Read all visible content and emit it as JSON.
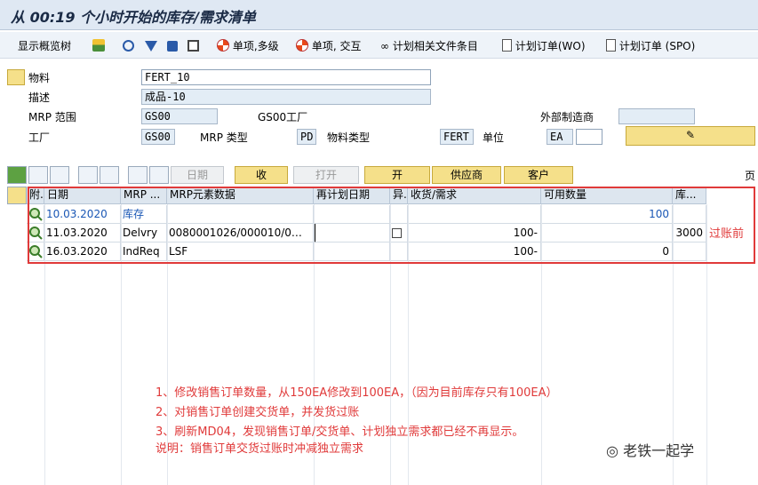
{
  "title": "从 00:19 个小时开始的库存/需求清单",
  "toolbar": {
    "overview": "显示概览树",
    "single_multi": "单项,多级",
    "single_interactive": "单项, 交互",
    "plan_docs": "计划相关文件条目",
    "plan_order_wo": "计划订单(WO)",
    "plan_order_spo": "计划订单 (SPO)"
  },
  "header": {
    "material_label": "物料",
    "material_value": "FERT_10",
    "desc_label": "描述",
    "desc_value": "成品-10",
    "mrp_area_label": "MRP 范围",
    "mrp_area_value": "GS00",
    "mrp_area_text": "GS00工厂",
    "ext_proc_label": "外部制造商",
    "plant_label": "工厂",
    "plant_value": "GS00",
    "mrp_type_label": "MRP 类型",
    "mrp_type_value": "PD",
    "mat_type_label": "物料类型",
    "mat_type_value": "FERT",
    "unit_label": "单位",
    "unit_value": "EA"
  },
  "action_buttons": {
    "date": "日期",
    "receive": "收",
    "open": "打开",
    "open2": "开",
    "vendor": "供应商",
    "customer": "客户",
    "page": "页"
  },
  "grid": {
    "columns": [
      "附.",
      "日期",
      "MRP ...",
      "MRP元素数据",
      "再计划日期",
      "异.",
      "收货/需求",
      "可用数量",
      "库..."
    ],
    "rows": [
      {
        "date": "10.03.2020",
        "mrp": "库存",
        "elem": "",
        "resched": "",
        "exc": "",
        "recv": "",
        "avail": "100",
        "stor": "",
        "blue": true
      },
      {
        "date": "11.03.2020",
        "mrp": "Delvry",
        "elem": "0080001026/000010/0…",
        "resched": "",
        "exc": "",
        "recv": "100-",
        "avail": "",
        "stor": "3000",
        "blue": false
      },
      {
        "date": "16.03.2020",
        "mrp": "IndReq",
        "elem": "LSF",
        "resched": "",
        "exc": "",
        "recv": "100-",
        "avail": "0",
        "stor": "",
        "blue": false
      }
    ],
    "side_note": "过账前"
  },
  "notes": [
    "1、修改销售订单数量，从150EA修改到100EA，（因为目前库存只有100EA）",
    "2、对销售订单创建交货单，并发货过账",
    "3、刷新MD04，发现销售订单/交货单、计划独立需求都已经不再显示。",
    "说明：销售订单交货过账时冲减独立需求"
  ],
  "watermark": "老铁一起学",
  "colors": {
    "highlight": "#e03a3a",
    "header_bg": "#dfe8f3",
    "button": "#f5e08a"
  }
}
